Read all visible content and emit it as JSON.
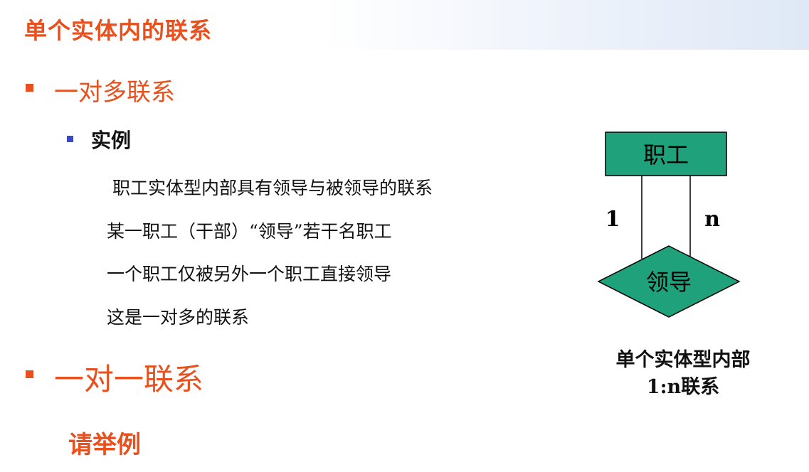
{
  "slide": {
    "title": "单个实体内的联系",
    "section1": "一对多联系",
    "example_label": "实例",
    "lines": [
      "职工实体型内部具有领导与被领导的联系",
      "某一职工（干部）“领导”若干名职工",
      "一个职工仅被另外一个职工直接领导",
      "这是一对多的联系"
    ],
    "section2": "一对一联系",
    "prompt": "请举例"
  },
  "diagram": {
    "entity": "职工",
    "relationship": "领导",
    "cardinality_left": "1",
    "cardinality_right": "n",
    "caption_line1": "单个实体型内部",
    "caption_line2": "1:n联系",
    "fill_color": "#1fa27c"
  }
}
